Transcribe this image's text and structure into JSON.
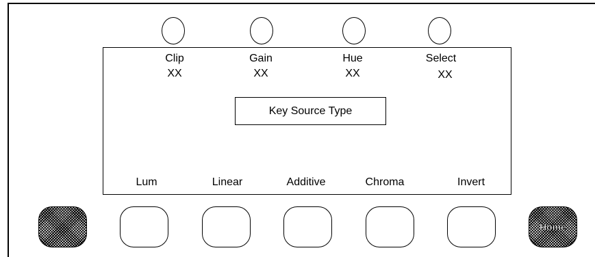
{
  "params": [
    {
      "label": "Clip",
      "value": "XX"
    },
    {
      "label": "Gain",
      "value": "XX"
    },
    {
      "label": "Hue",
      "value": "XX"
    },
    {
      "label": "Select",
      "value": "XX"
    }
  ],
  "center_box": {
    "label": "Key Source Type"
  },
  "soft_keys": [
    {
      "label": "Lum"
    },
    {
      "label": "Linear"
    },
    {
      "label": "Additive"
    },
    {
      "label": "Chroma"
    },
    {
      "label": "Invert"
    }
  ],
  "side_buttons": {
    "right_label": "Home"
  }
}
